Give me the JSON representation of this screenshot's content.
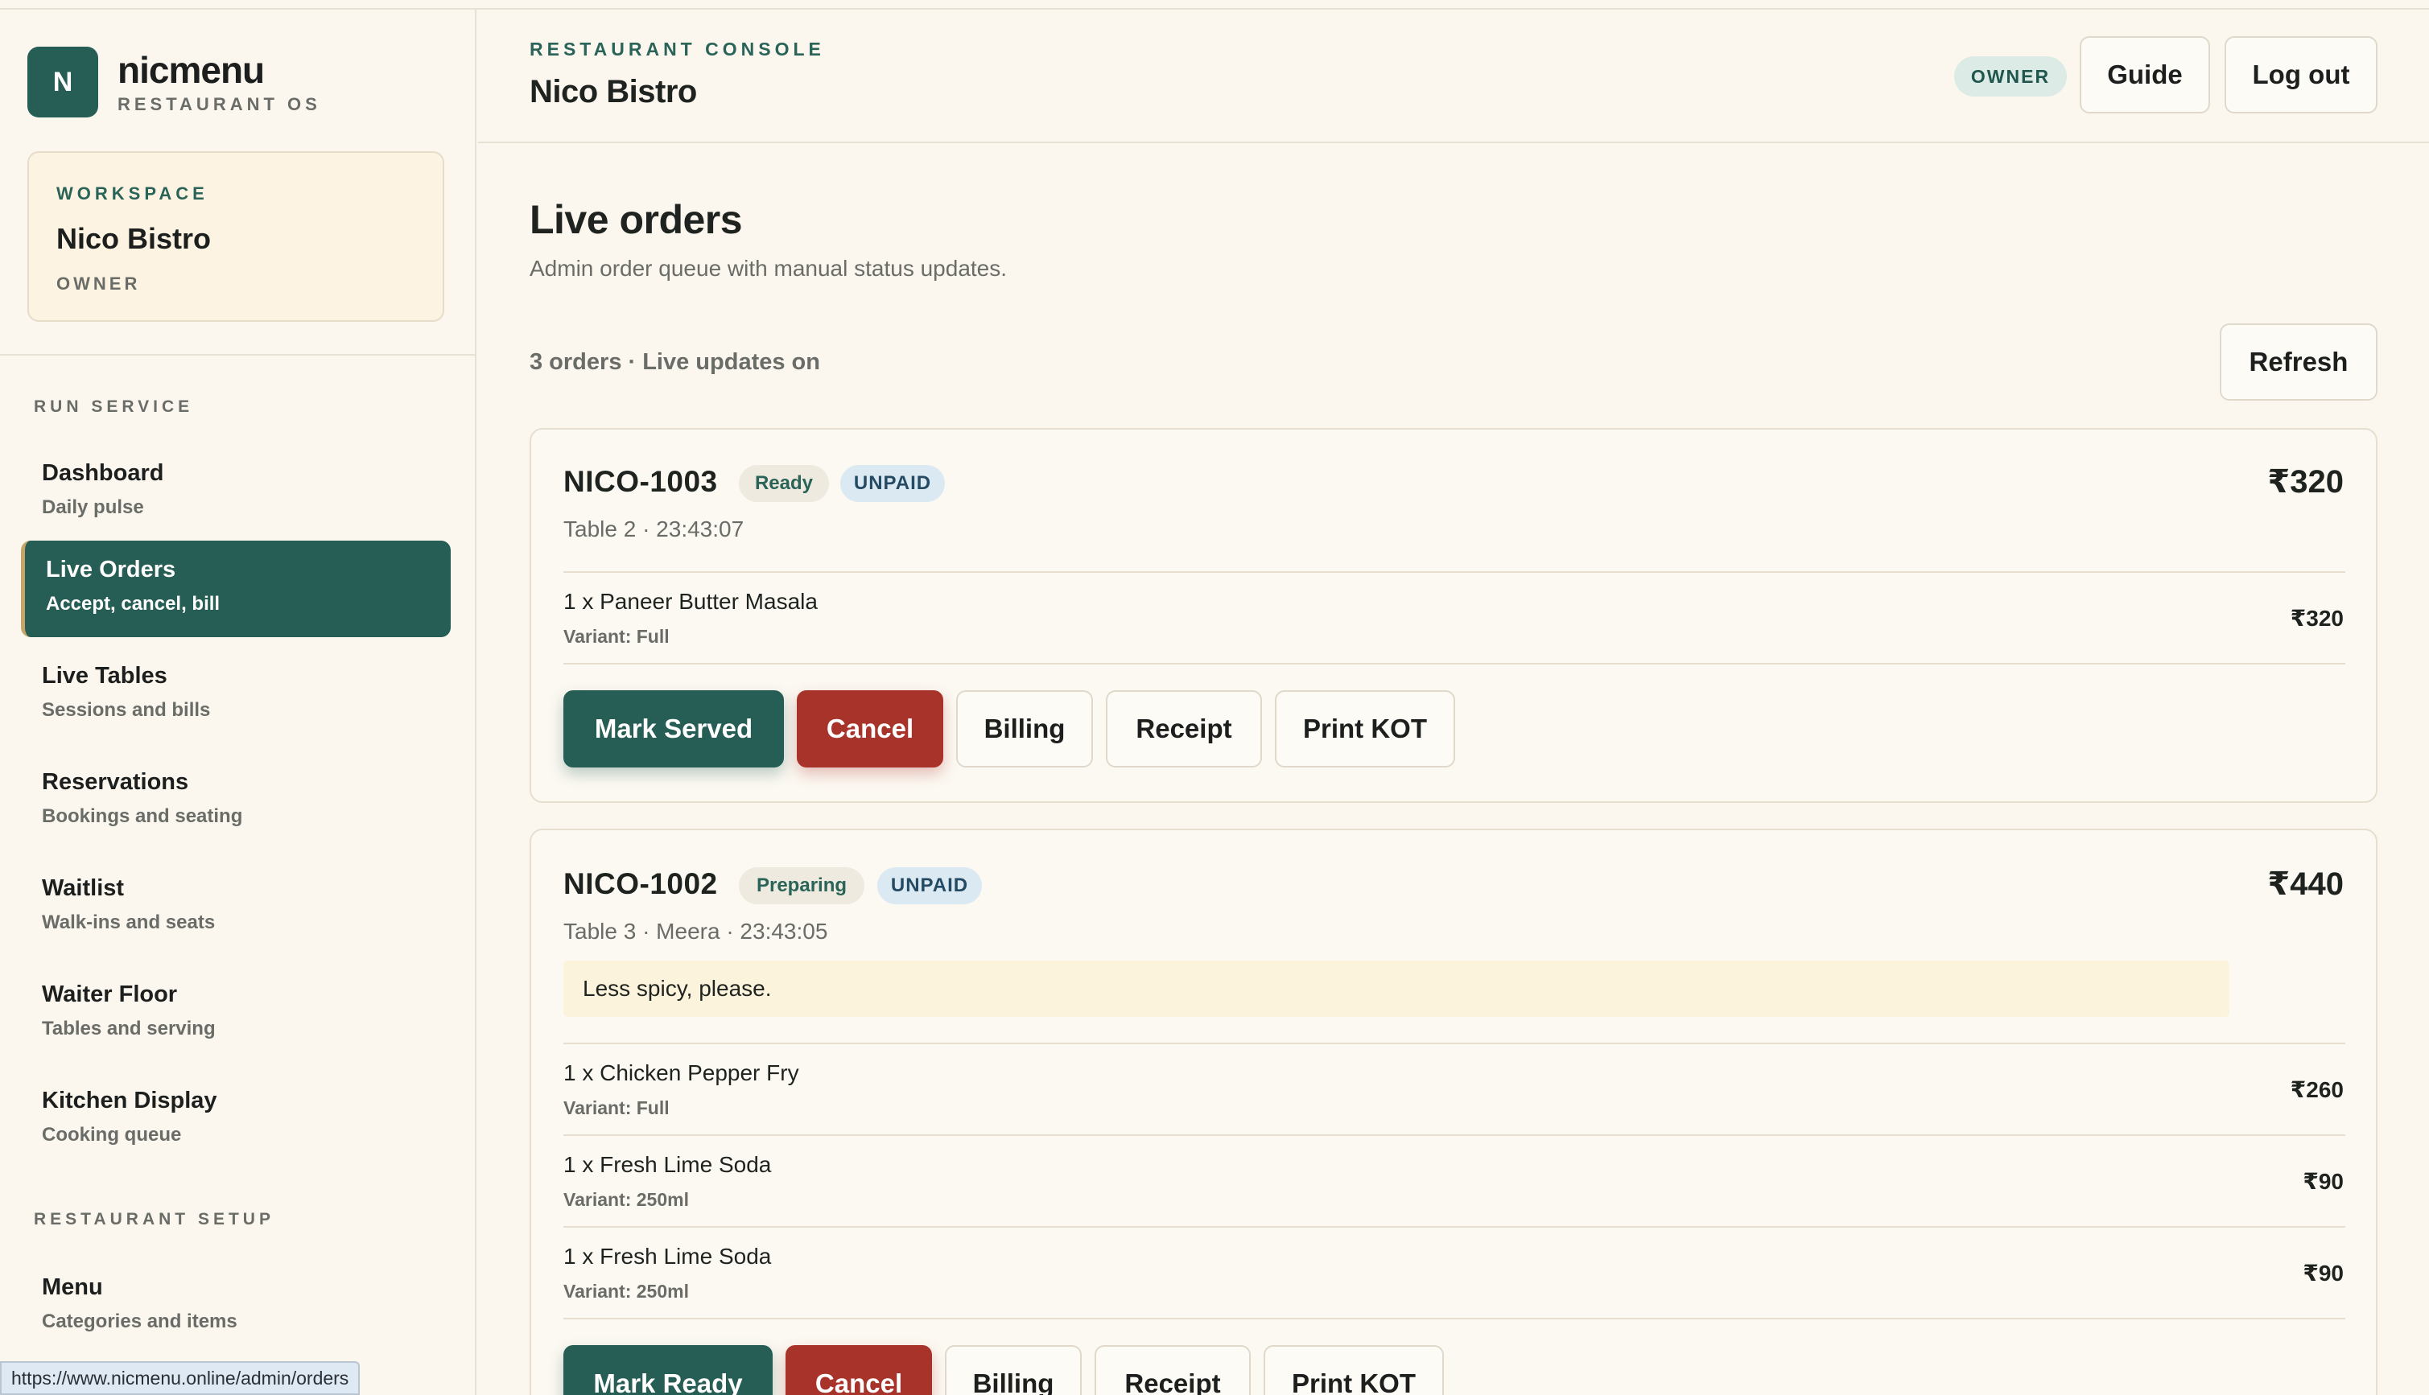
{
  "brand": {
    "logo_letter": "N",
    "name": "nicmenu",
    "subtitle": "RESTAURANT OS"
  },
  "workspace": {
    "label": "WORKSPACE",
    "name": "Nico Bistro",
    "role": "OWNER"
  },
  "sidebar": {
    "run_service_label": "RUN SERVICE",
    "run_items": [
      {
        "title": "Dashboard",
        "subtitle": "Daily pulse"
      },
      {
        "title": "Live Orders",
        "subtitle": "Accept, cancel, bill"
      },
      {
        "title": "Live Tables",
        "subtitle": "Sessions and bills"
      },
      {
        "title": "Reservations",
        "subtitle": "Bookings and seating"
      },
      {
        "title": "Waitlist",
        "subtitle": "Walk-ins and seats"
      },
      {
        "title": "Waiter Floor",
        "subtitle": "Tables and serving"
      },
      {
        "title": "Kitchen Display",
        "subtitle": "Cooking queue"
      }
    ],
    "setup_label": "RESTAURANT SETUP",
    "setup_items": [
      {
        "title": "Menu",
        "subtitle": "Categories and items"
      }
    ]
  },
  "status_bar_url": "https://www.nicmenu.online/admin/orders",
  "header": {
    "kicker": "RESTAURANT CONSOLE",
    "title": "Nico Bistro",
    "role_badge": "OWNER",
    "guide_label": "Guide",
    "logout_label": "Log out"
  },
  "main": {
    "title": "Live orders",
    "subtitle": "Admin order queue with manual status updates.",
    "count_line": "3 orders · Live updates on",
    "refresh_label": "Refresh"
  },
  "orders": [
    {
      "id": "NICO-1003",
      "status": "Ready",
      "payment": "UNPAID",
      "total": "₹320",
      "meta": "Table 2 · 23:43:07",
      "items": [
        {
          "name": "1 x Paneer Butter Masala",
          "variant": "Variant: Full",
          "price": "₹320"
        }
      ],
      "actions": [
        "Mark Served",
        "Cancel",
        "Billing",
        "Receipt",
        "Print KOT"
      ]
    },
    {
      "id": "NICO-1002",
      "status": "Preparing",
      "payment": "UNPAID",
      "total": "₹440",
      "meta": "Table 3 · Meera · 23:43:05",
      "note": "Less spicy, please.",
      "items": [
        {
          "name": "1 x Chicken Pepper Fry",
          "variant": "Variant: Full",
          "price": "₹260"
        },
        {
          "name": "1 x Fresh Lime Soda",
          "variant": "Variant: 250ml",
          "price": "₹90"
        },
        {
          "name": "1 x Fresh Lime Soda",
          "variant": "Variant: 250ml",
          "price": "₹90"
        }
      ],
      "actions": [
        "Mark Ready",
        "Cancel",
        "Billing",
        "Receipt",
        "Print KOT"
      ]
    }
  ],
  "colors": {
    "primary": "#265e55",
    "danger": "#a8332a",
    "background": "#fbf7ee"
  }
}
